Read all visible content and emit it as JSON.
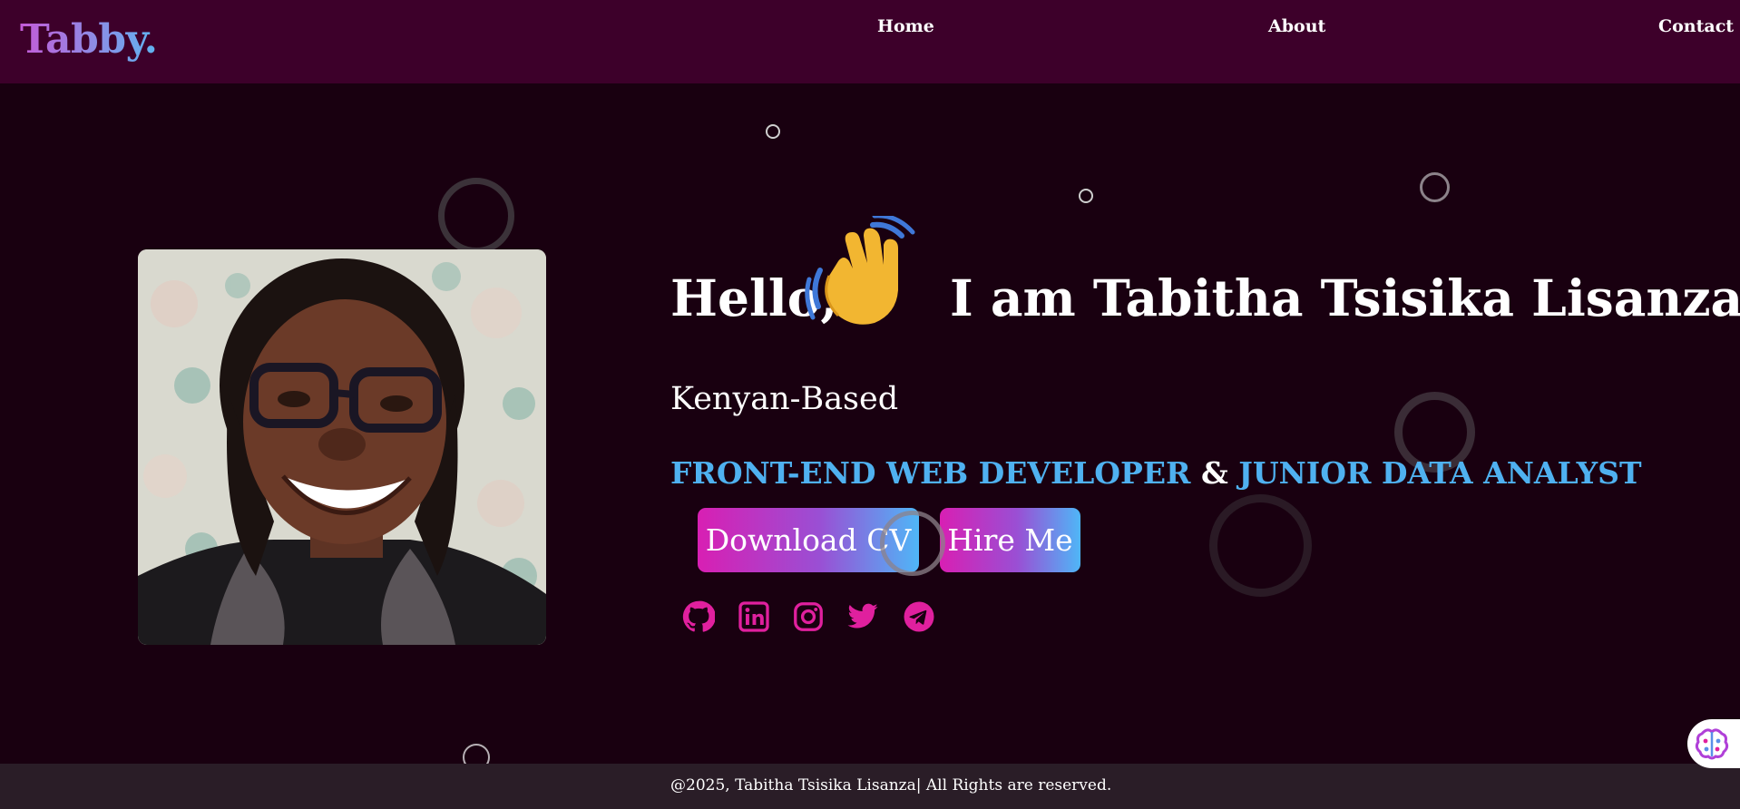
{
  "nav": {
    "logo": "Tabby.",
    "links": [
      "Home",
      "About",
      "Contact"
    ]
  },
  "hero": {
    "greeting": "Hello,",
    "wave_icon": "waving-hand-icon",
    "name": "I am Tabitha Tsisika Lisanza",
    "location": "Kenyan-Based",
    "role_1": "FRONT-END WEB DEVELOPER",
    "role_joiner": " & ",
    "role_2": "JUNIOR DATA ANALYST",
    "buttons": {
      "download_cv": "Download CV",
      "hire_me": "Hire Me"
    },
    "socials": [
      "github-icon",
      "linkedin-icon",
      "instagram-icon",
      "twitter-icon",
      "telegram-icon"
    ]
  },
  "footer": {
    "text": "@2025, Tabitha Tsisika Lisanza| All Rights are reserved."
  },
  "colors": {
    "nav_bg": "#3d002a",
    "page_bg": "#190010",
    "accent_pink": "#d81fb3",
    "accent_blue": "#4fb1f0",
    "footer_bg": "#2a1d27"
  }
}
